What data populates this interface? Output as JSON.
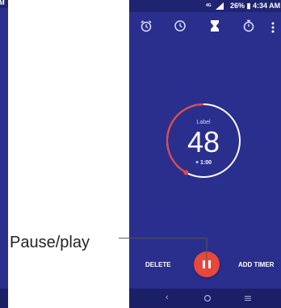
{
  "left_partial": {
    "status_fragment": "M"
  },
  "status_bar": {
    "text": "26% ▮ 4:34 AM"
  },
  "tabs": [
    {
      "icon": "alarm-icon"
    },
    {
      "icon": "clock-icon"
    },
    {
      "icon": "timer-icon",
      "active": true
    },
    {
      "icon": "stopwatch-icon"
    }
  ],
  "timer": {
    "label": "Label",
    "value": "48",
    "add": "+ 1:00",
    "progress": 0.42
  },
  "actions": {
    "delete": "DELETE",
    "add_timer": "ADD TIMER"
  },
  "callout": {
    "text": "Pause/play"
  },
  "colors": {
    "background": "#2a2f8e",
    "accent": "#e8473b"
  }
}
